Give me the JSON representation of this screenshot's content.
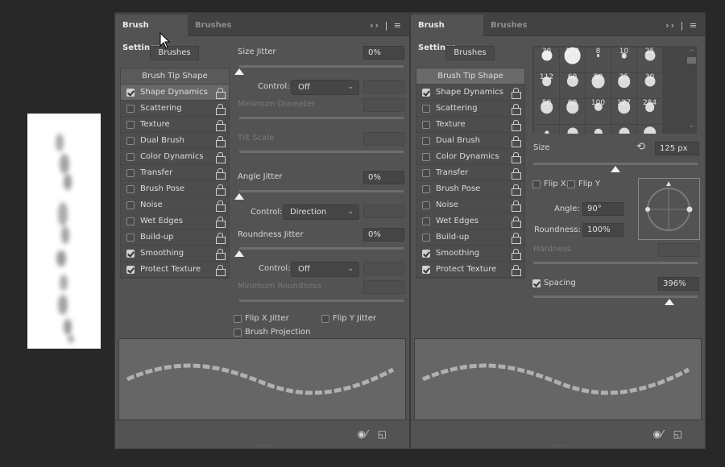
{
  "canvas": {
    "description_icon": "brush-stroke-canvas"
  },
  "panels": [
    {
      "tabs": [
        "Brush Settings",
        "Brushes"
      ],
      "active_tab": 0,
      "menu_icons": [
        "collapse-icon",
        "menu-icon"
      ],
      "brushes_button": "Brushes",
      "list": {
        "header": "Brush Tip Shape",
        "items": [
          {
            "label": "Shape Dynamics",
            "checked": true,
            "selected": true
          },
          {
            "label": "Scattering",
            "checked": false
          },
          {
            "label": "Texture",
            "checked": false
          },
          {
            "label": "Dual Brush",
            "checked": false
          },
          {
            "label": "Color Dynamics",
            "checked": false
          },
          {
            "label": "Transfer",
            "checked": false
          },
          {
            "label": "Brush Pose",
            "checked": false
          },
          {
            "label": "Noise",
            "checked": false
          },
          {
            "label": "Wet Edges",
            "checked": false
          },
          {
            "label": "Build-up",
            "checked": false
          },
          {
            "label": "Smoothing",
            "checked": true
          },
          {
            "label": "Protect Texture",
            "checked": true
          }
        ]
      },
      "shape_dynamics": {
        "size_jitter": {
          "label": "Size Jitter",
          "value": "0%"
        },
        "control1": {
          "label": "Control:",
          "value": "Off"
        },
        "min_diameter": {
          "label": "Minimum Diameter"
        },
        "tilt_scale": {
          "label": "Tilt Scale"
        },
        "angle_jitter": {
          "label": "Angle Jitter",
          "value": "0%"
        },
        "control2": {
          "label": "Control:",
          "value": "Direction"
        },
        "roundness_jitter": {
          "label": "Roundness Jitter",
          "value": "0%"
        },
        "control3": {
          "label": "Control:",
          "value": "Off"
        },
        "min_roundness": {
          "label": "Minimum Roundness"
        },
        "flip_x_jitter": {
          "label": "Flip X Jitter",
          "checked": false
        },
        "flip_y_jitter": {
          "label": "Flip Y Jitter",
          "checked": false
        },
        "brush_projection": {
          "label": "Brush Projection",
          "checked": false
        }
      }
    },
    {
      "tabs": [
        "Brush Settings",
        "Brushes"
      ],
      "active_tab": 0,
      "brushes_button": "Brushes",
      "list": {
        "header": "Brush Tip Shape",
        "header_selected": true,
        "items": [
          {
            "label": "Shape Dynamics",
            "checked": true
          },
          {
            "label": "Scattering",
            "checked": false
          },
          {
            "label": "Texture",
            "checked": false
          },
          {
            "label": "Dual Brush",
            "checked": false
          },
          {
            "label": "Color Dynamics",
            "checked": false
          },
          {
            "label": "Transfer",
            "checked": false
          },
          {
            "label": "Brush Pose",
            "checked": false
          },
          {
            "label": "Noise",
            "checked": false
          },
          {
            "label": "Wet Edges",
            "checked": false
          },
          {
            "label": "Build-up",
            "checked": false
          },
          {
            "label": "Smoothing",
            "checked": true
          },
          {
            "label": "Protect Texture",
            "checked": true
          }
        ]
      },
      "tip_shape": {
        "presets": [
          "30",
          "123",
          "8",
          "10",
          "25",
          "112",
          "60",
          "50",
          "25",
          "30",
          "50",
          "60",
          "100",
          "127",
          "284",
          "",
          "",
          "",
          "",
          ""
        ],
        "size": {
          "label": "Size",
          "value": "125 px",
          "fraction": 0.5
        },
        "flip_x": {
          "label": "Flip X",
          "checked": false
        },
        "flip_y": {
          "label": "Flip Y",
          "checked": false
        },
        "angle": {
          "label": "Angle:",
          "value": "90°"
        },
        "roundness": {
          "label": "Roundness:",
          "value": "100%"
        },
        "hardness": {
          "label": "Hardness"
        },
        "spacing": {
          "label": "Spacing",
          "value": "396%",
          "checked": true,
          "fraction": 0.83
        }
      }
    }
  ],
  "footer_icons": [
    "visibility-toggle-icon",
    "new-preset-icon"
  ],
  "colors": {
    "panel": "#535353",
    "tabbar": "#424242",
    "background": "#282828"
  }
}
